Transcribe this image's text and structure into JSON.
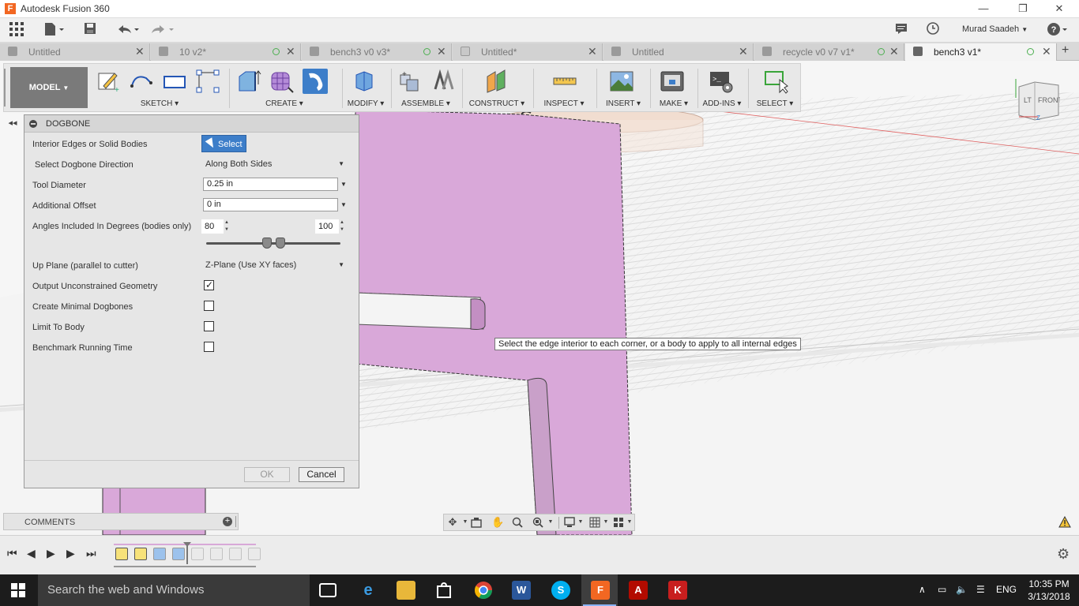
{
  "app": {
    "title": "Autodesk Fusion 360",
    "logo_letter": "F",
    "user": "Murad Saadeh"
  },
  "window_controls": {
    "minimize": "—",
    "restore": "❐",
    "close": "✕"
  },
  "tabs": [
    {
      "label": "Untitled",
      "active": false,
      "status_dot": false
    },
    {
      "label": "10 v2*",
      "active": false,
      "status_dot": true
    },
    {
      "label": "bench3 v0 v3*",
      "active": false,
      "status_dot": true
    },
    {
      "label": "Untitled*",
      "active": false,
      "status_dot": false
    },
    {
      "label": "Untitled",
      "active": false,
      "status_dot": false
    },
    {
      "label": "recycle v0 v7 v1*",
      "active": false,
      "status_dot": true
    },
    {
      "label": "bench3 v1*",
      "active": true,
      "status_dot": true
    }
  ],
  "ribbon": {
    "workspace": "MODEL",
    "groups": {
      "sketch": "SKETCH",
      "create": "CREATE",
      "modify": "MODIFY",
      "assemble": "ASSEMBLE",
      "construct": "CONSTRUCT",
      "inspect": "INSPECT",
      "insert": "INSERT",
      "make": "MAKE",
      "addins": "ADD-INS",
      "select": "SELECT"
    }
  },
  "viewcube": {
    "face": "FRONT",
    "side": "LT",
    "axis_z": "Z"
  },
  "dialog": {
    "title": "DOGBONE",
    "rows": {
      "interior_edges": "Interior Edges or Solid Bodies",
      "direction": "Select Dogbone Direction",
      "tool_diameter": "Tool Diameter",
      "additional_offset": "Additional Offset",
      "angles": "Angles Included In Degrees (bodies only)",
      "up_plane": "Up Plane (parallel to cutter)",
      "output_unconstrained": "Output Unconstrained Geometry",
      "minimal_dogbones": "Create Minimal Dogbones",
      "limit_to_body": "Limit To Body",
      "benchmark": "Benchmark Running Time"
    },
    "select_button": "Select",
    "direction_value": "Along Both Sides",
    "tool_diameter_value": "0.25 in",
    "additional_offset_value": "0 in",
    "angle_min": "80",
    "angle_max": "100",
    "angle_range_fraction": [
      0.45,
      0.55
    ],
    "up_plane_value": "Z-Plane (Use XY faces)",
    "checkboxes": {
      "output_unconstrained": true,
      "minimal_dogbones": false,
      "limit_to_body": false,
      "benchmark": false
    },
    "ok": "OK",
    "cancel": "Cancel"
  },
  "tooltip": "Select the edge interior to each corner, or a body to apply to all internal edges",
  "comments": {
    "label": "COMMENTS",
    "plus": "+"
  },
  "taskbar": {
    "search_placeholder": "Search the web and Windows",
    "language": "ENG",
    "time": "10:35 PM",
    "date": "3/13/2018"
  },
  "colors": {
    "body_pink": "#d9a8d9",
    "select_blue": "#3d7ec9",
    "taskbar": "#1c1c1c"
  }
}
